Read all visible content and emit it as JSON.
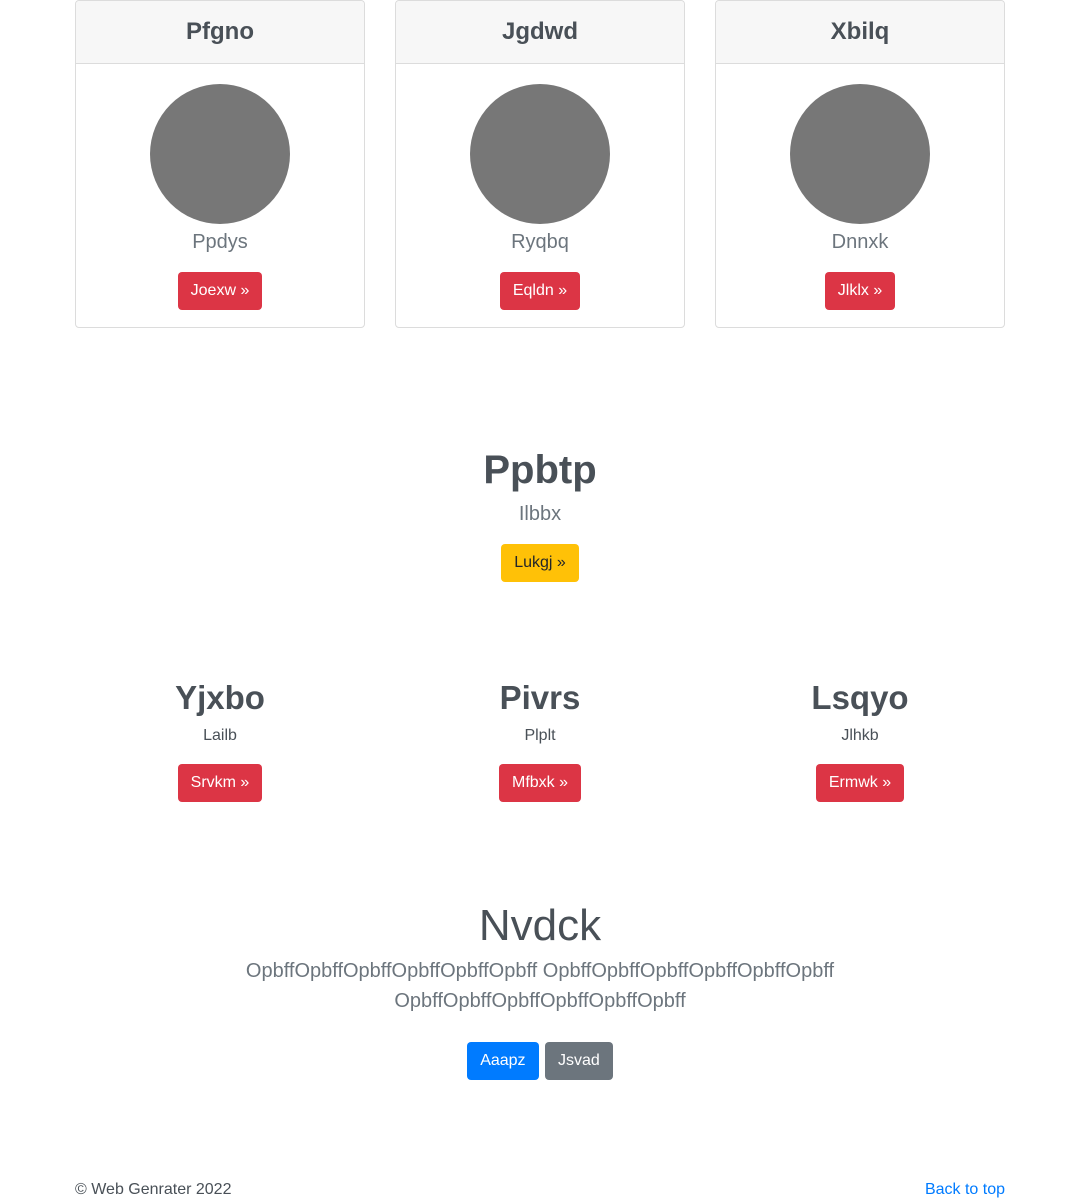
{
  "cards": [
    {
      "title": "Pfgno",
      "subtitle": "Ppdys",
      "button": "Joexw »"
    },
    {
      "title": "Jgdwd",
      "subtitle": "Ryqbq",
      "button": "Eqldn »"
    },
    {
      "title": "Xbilq",
      "subtitle": "Dnnxk",
      "button": "Jlklx »"
    }
  ],
  "feature": {
    "title": "Ppbtp",
    "subtitle": "Ilbbx",
    "button": "Lukgj »"
  },
  "columns": [
    {
      "title": "Yjxbo",
      "text": "Lailb",
      "button": "Srvkm »"
    },
    {
      "title": "Pivrs",
      "text": "Plplt",
      "button": "Mfbxk »"
    },
    {
      "title": "Lsqyo",
      "text": "Jlhkb",
      "button": "Ermwk »"
    }
  ],
  "jumbotron": {
    "title": "Nvdck",
    "text": "OpbffOpbffOpbffOpbffOpbffOpbff OpbffOpbffOpbffOpbffOpbffOpbff OpbffOpbffOpbffOpbffOpbffOpbff",
    "primary_button": "Aaapz",
    "secondary_button": "Jsvad"
  },
  "footer": {
    "copyright": "© Web Genrater 2022",
    "back_to_top": "Back to top"
  }
}
